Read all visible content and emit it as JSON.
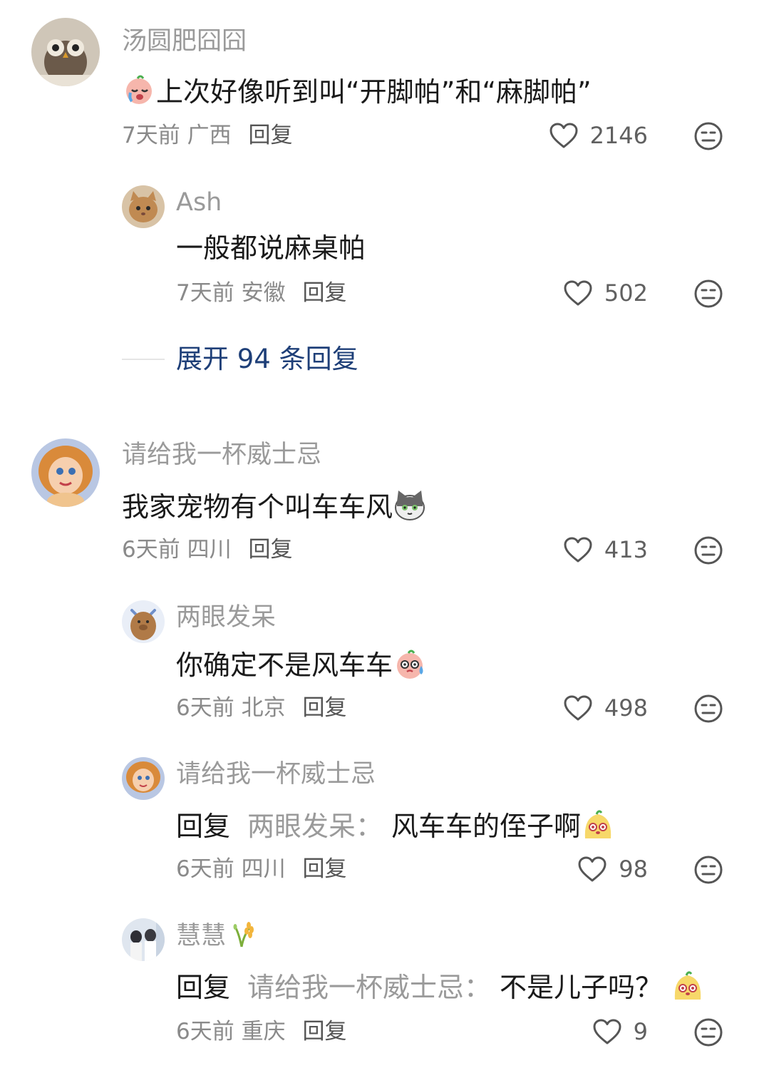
{
  "comments": [
    {
      "username": "汤圆肥囧囧",
      "text": "上次好像听到叫“开脚帕”和“麻脚帕”",
      "time": "7天前",
      "location": "广西",
      "reply_label": "回复",
      "likes": "2146",
      "replies": [
        {
          "username": "Ash",
          "text": "一般都说麻桌帕",
          "time": "7天前",
          "location": "安徽",
          "reply_label": "回复",
          "likes": "502"
        }
      ],
      "expand_label": "展开 94 条回复"
    },
    {
      "username": "请给我一杯威士忌",
      "text": "我家宠物有个叫车车风",
      "time": "6天前",
      "location": "四川",
      "reply_label": "回复",
      "likes": "413",
      "replies": [
        {
          "username": "两眼发呆",
          "text": "你确定不是风车车",
          "time": "6天前",
          "location": "北京",
          "reply_label": "回复",
          "likes": "498"
        },
        {
          "username": "请给我一杯威士忌",
          "reply_prefix": "回复",
          "reply_to": "两眼发呆：",
          "text": "风车车的侄子啊",
          "time": "6天前",
          "location": "四川",
          "reply_label": "回复",
          "likes": "98"
        },
        {
          "username": "慧慧",
          "reply_prefix": "回复",
          "reply_to": "请给我一杯威士忌：",
          "text": "不是儿子吗？",
          "time": "6天前",
          "location": "重庆",
          "reply_label": "回复",
          "likes": "9"
        }
      ]
    }
  ],
  "colors": {
    "username": "#9a9a9a",
    "text": "#1a1a1a",
    "link": "#1e3f78",
    "meta": "#8a8a8a"
  }
}
